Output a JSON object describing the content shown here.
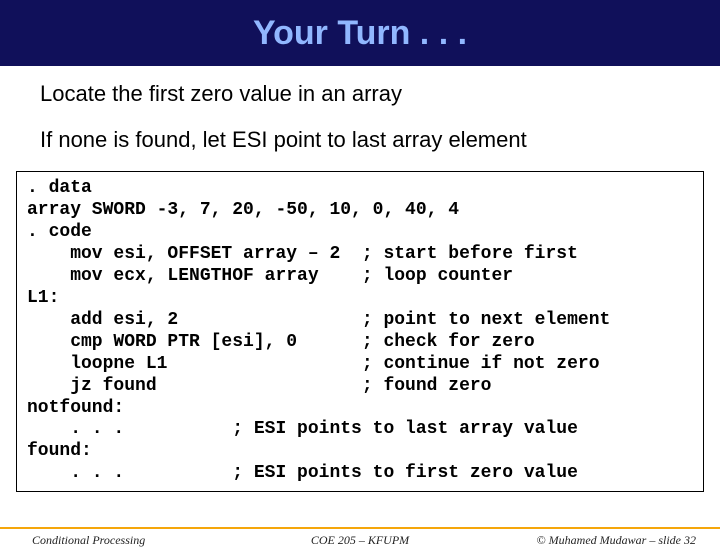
{
  "title": "Your Turn . . .",
  "instructions": [
    "Locate the first zero value in an array",
    "If none is found, let ESI point to last array element"
  ],
  "code": ". data\narray SWORD -3, 7, 20, -50, 10, 0, 40, 4\n. code\n    mov esi, OFFSET array – 2  ; start before first\n    mov ecx, LENGTHOF array    ; loop counter\nL1:\n    add esi, 2                 ; point to next element\n    cmp WORD PTR [esi], 0      ; check for zero\n    loopne L1                  ; continue if not zero\n    jz found                   ; found zero\nnotfound:\n    . . .          ; ESI points to last array value\nfound:\n    . . .          ; ESI points to first zero value",
  "footer": {
    "left": "Conditional Processing",
    "center": "COE 205 – KFUPM",
    "right": "© Muhamed Mudawar – slide 32"
  }
}
